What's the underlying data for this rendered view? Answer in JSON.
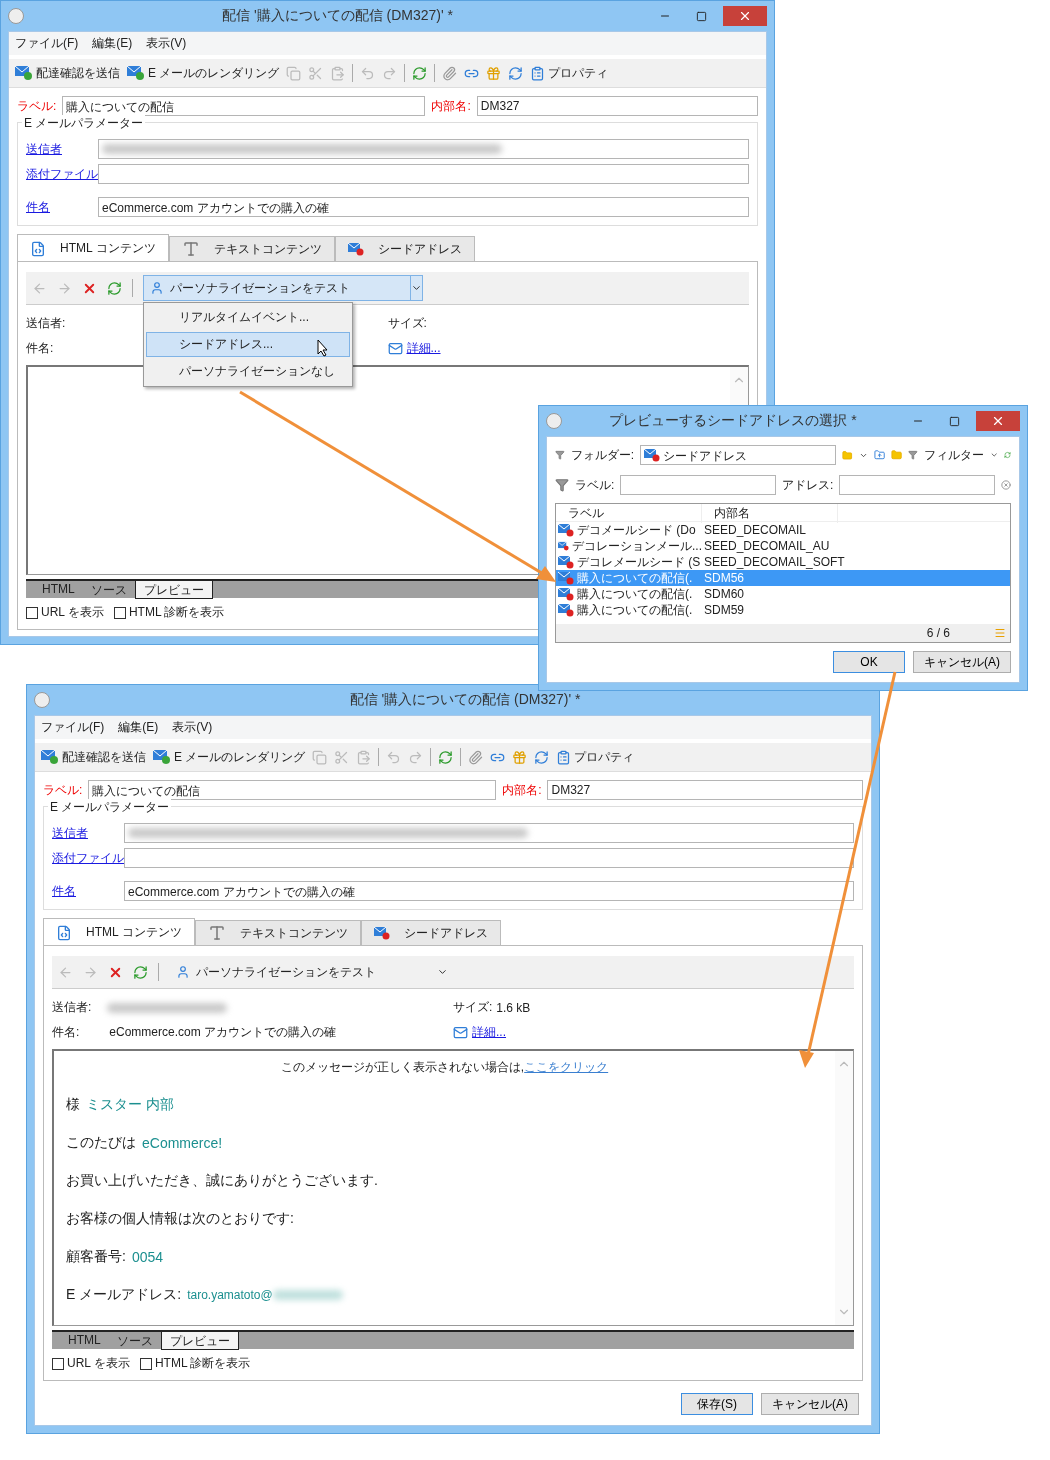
{
  "editor_windows": [
    {
      "title": "配信 '購入についての配信 (DM327)' *",
      "controls": true,
      "menu": [
        "ファイル(F)",
        "編集(E)",
        "表示(V)"
      ],
      "toolbar": {
        "send_proof": "配達確認を送信",
        "rendering": "E メールのレンダリング",
        "properties": "プロパティ"
      },
      "label_field": {
        "label": "ラベル:",
        "value": "購入についての配信"
      },
      "internal_name": {
        "label": "内部名:",
        "value": "DM327"
      },
      "group_title": "E メールパラメーター",
      "fields": [
        {
          "label": "送信者",
          "blurred": true
        },
        {
          "label": "添付ファイル"
        },
        {
          "label": "件名",
          "value": "eCommerce.com アカウントでの購入の確"
        }
      ],
      "tabs": [
        {
          "label": "HTML コンテンツ",
          "selected": true
        },
        {
          "label": "テキストコンテンツ",
          "selected": false
        },
        {
          "label": "シードアドレス",
          "selected": false
        }
      ],
      "personalization": {
        "label": "パーソナライゼーションをテスト",
        "expanded": true,
        "menu": [
          {
            "label": "リアルタイムイベント...",
            "selected": false
          },
          {
            "label": "シードアドレス...",
            "selected": true
          },
          {
            "label": "パーソナライゼーションなし",
            "selected": false
          }
        ]
      },
      "preview": {
        "sender_label": "送信者:",
        "subject_label": "件名:",
        "size_label": "サイズ:",
        "details_link": "詳細..."
      },
      "view_tabs": [
        {
          "label": "HTML",
          "selected": false
        },
        {
          "label": "ソース",
          "selected": false
        },
        {
          "label": "プレビュー",
          "selected": true
        }
      ],
      "checkboxes": [
        {
          "label": "URL を表示",
          "checked": false
        },
        {
          "label": "HTML 診断を表示",
          "checked": false
        }
      ]
    },
    {
      "title": "配信 '購入についての配信 (DM327)' *",
      "controls": false,
      "menu": [
        "ファイル(F)",
        "編集(E)",
        "表示(V)"
      ],
      "toolbar": {
        "send_proof": "配達確認を送信",
        "rendering": "E メールのレンダリング",
        "properties": "プロパティ"
      },
      "label_field": {
        "label": "ラベル:",
        "value": "購入についての配信"
      },
      "internal_name": {
        "label": "内部名:",
        "value": "DM327"
      },
      "group_title": "E メールパラメーター",
      "fields": [
        {
          "label": "送信者",
          "blurred": true
        },
        {
          "label": "添付ファイル"
        },
        {
          "label": "件名",
          "value": "eCommerce.com アカウントでの購入の確"
        }
      ],
      "tabs": [
        {
          "label": "HTML コンテンツ",
          "selected": true
        },
        {
          "label": "テキストコンテンツ",
          "selected": false
        },
        {
          "label": "シードアドレス",
          "selected": false
        }
      ],
      "personalization": {
        "label": "パーソナライゼーションをテスト",
        "expanded": false
      },
      "preview": {
        "sender_label": "送信者:",
        "sender_blurred": true,
        "subject_label": "件名:",
        "subject_value": "eCommerce.com アカウントでの購入の確",
        "size_label": "サイズ:",
        "size_value": "1.6 kB",
        "details_link": "詳細...",
        "notice": "このメッセージが正しく表示されない場合は,",
        "notice_link": "ここをクリック",
        "body": [
          {
            "text": "様",
            "value": "ミスター 内部"
          },
          {
            "text": "このたびは",
            "value": "eCommerce!"
          },
          {
            "text": "お買い上げいただき、誠にありがとうございます."
          },
          {
            "text": "お客様の個人情報は次のとおりです:"
          },
          {
            "text": "顧客番号:",
            "value": "0054"
          },
          {
            "text": "E メールアドレス:",
            "value": "taro.yamatoto@",
            "blurred_suffix": true
          }
        ]
      },
      "view_tabs": [
        {
          "label": "HTML",
          "selected": false
        },
        {
          "label": "ソース",
          "selected": false
        },
        {
          "label": "プレビュー",
          "selected": true
        }
      ],
      "checkboxes": [
        {
          "label": "URL を表示",
          "checked": false
        },
        {
          "label": "HTML 診断を表示",
          "checked": false
        }
      ],
      "buttons": [
        "保存(S)",
        "キャンセル(A)"
      ]
    }
  ],
  "seed_dialog": {
    "title": "プレビューするシードアドレスの選択 *",
    "folder_label": "フォルダー:",
    "folder_value": "シードアドレス",
    "filter": "フィルター",
    "label_label": "ラベル:",
    "address_label": "アドレス:",
    "columns": [
      "ラベル",
      "内部名"
    ],
    "rows": [
      {
        "label": "デコメールシード (Do",
        "name": "SEED_DECOMAIL",
        "selected": false
      },
      {
        "label": "デコレーションメール...",
        "name": "SEED_DECOMAIL_AU",
        "selected": false
      },
      {
        "label": "デコレメールシード (S",
        "name": "SEED_DECOMAIL_SOFT",
        "selected": false
      },
      {
        "label": "購入についての配信(.",
        "name": "SDM56",
        "selected": true
      },
      {
        "label": "購入についての配信(.",
        "name": "SDM60",
        "selected": false
      },
      {
        "label": "購入についての配信(.",
        "name": "SDM59",
        "selected": false
      }
    ],
    "count": "6 / 6",
    "buttons": [
      "OK",
      "キャンセル(A)"
    ]
  }
}
